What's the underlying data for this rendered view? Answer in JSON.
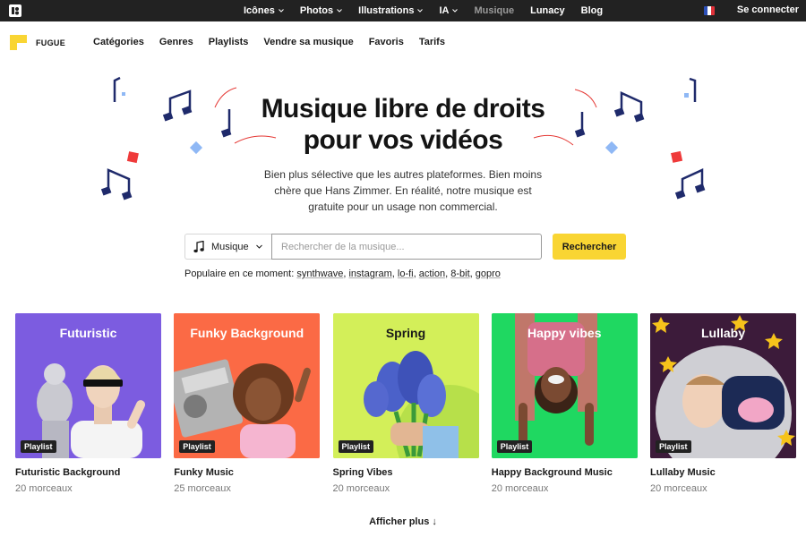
{
  "topbar": {
    "nav": [
      {
        "label": "Icônes",
        "dropdown": true,
        "active": false
      },
      {
        "label": "Photos",
        "dropdown": true,
        "active": false
      },
      {
        "label": "Illustrations",
        "dropdown": true,
        "active": false
      },
      {
        "label": "IA",
        "dropdown": true,
        "active": false
      },
      {
        "label": "Musique",
        "dropdown": false,
        "active": true
      },
      {
        "label": "Lunacy",
        "dropdown": false,
        "active": false
      },
      {
        "label": "Blog",
        "dropdown": false,
        "active": false
      }
    ],
    "language_flag": "fr-flag-icon",
    "signin_label": "Se connecter",
    "background": "#222222"
  },
  "subnav": {
    "brand_name": "FUGUE",
    "brand_color": "#f9d533",
    "links": [
      "Catégories",
      "Genres",
      "Playlists",
      "Vendre sa musique",
      "Favoris",
      "Tarifs"
    ]
  },
  "hero": {
    "title_line1": "Musique libre de droits",
    "title_line2": "pour vos vidéos",
    "subtitle": "Bien plus sélective que les autres plateformes. Bien moins chère que Hans Zimmer. En réalité, notre musique est gratuite pour un usage non commercial."
  },
  "search": {
    "type_label": "Musique",
    "placeholder": "Rechercher de la musique...",
    "button_label": "Rechercher",
    "button_color": "#f9d533"
  },
  "popular": {
    "label": "Populaire en ce moment:",
    "tags": [
      "synthwave",
      "instagram",
      "lo-fi",
      "action",
      "8-bit",
      "gopro"
    ]
  },
  "cards": [
    {
      "thumb_title": "Futuristic",
      "badge": "Playlist",
      "title": "Futuristic Background",
      "count": "20 morceaux",
      "bg": "#7c5ce0"
    },
    {
      "thumb_title": "Funky Background",
      "badge": "Playlist",
      "title": "Funky Music",
      "count": "25 morceaux",
      "bg": "#fb6a45"
    },
    {
      "thumb_title": "Spring",
      "badge": "Playlist",
      "title": "Spring Vibes",
      "count": "20 morceaux",
      "bg": "#d3ef59"
    },
    {
      "thumb_title": "Happy vibes",
      "badge": "Playlist",
      "title": "Happy Background Music",
      "count": "20 morceaux",
      "bg": "#1fd861"
    },
    {
      "thumb_title": "Lullaby",
      "badge": "Playlist",
      "title": "Lullaby Music",
      "count": "20 morceaux",
      "bg": "#3c1b3a"
    }
  ],
  "more_label": "Afficher plus ↓",
  "colors": {
    "accent": "#f9d533",
    "note_color": "#1f2a6b",
    "red": "#ef3a3a",
    "blue_diamond": "#8fb8f5"
  }
}
